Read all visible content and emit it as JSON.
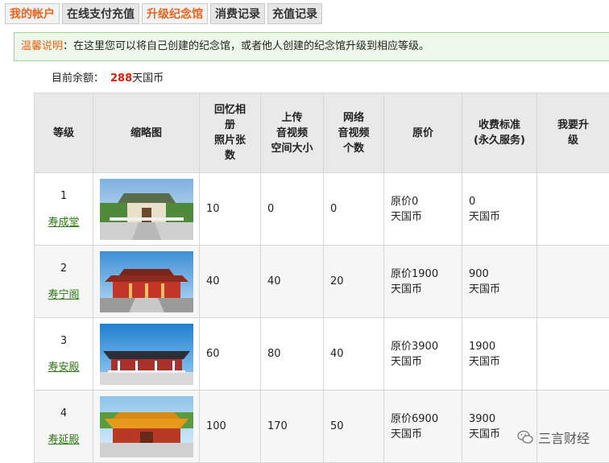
{
  "tabs": [
    {
      "label": "我的帐户"
    },
    {
      "label": "在线支付充值"
    },
    {
      "label": "升级纪念馆"
    },
    {
      "label": "消费记录"
    },
    {
      "label": "充值记录"
    }
  ],
  "notice": {
    "label": "温馨说明",
    "text": "：在这里您可以将自己创建的纪念馆，或者他人创建的纪念馆升级到相应等级。"
  },
  "balance": {
    "label": "目前余额：",
    "value": "288",
    "unit": "天国币"
  },
  "table": {
    "headers": {
      "level": "等级",
      "thumb": "缩略图",
      "photos": [
        "回忆相",
        "册",
        "照片张",
        "数"
      ],
      "space": [
        "上传",
        "音视频",
        "空间大小"
      ],
      "videos": [
        "网络",
        "音视频",
        "个数"
      ],
      "original": "原价",
      "fee": [
        "收费标准",
        "(永久服务)"
      ],
      "upgrade": [
        "我要升",
        "级"
      ]
    },
    "rows": [
      {
        "num": "1",
        "name": "寿成堂",
        "photos": "10",
        "space": "0",
        "videos": "0",
        "original": "原价0",
        "fee": "0",
        "unit": "天国币"
      },
      {
        "num": "2",
        "name": "寿宁阁",
        "photos": "40",
        "space": "40",
        "videos": "20",
        "original": "原价1900",
        "fee": "900",
        "unit": "天国币"
      },
      {
        "num": "3",
        "name": "寿安殿",
        "photos": "60",
        "space": "80",
        "videos": "40",
        "original": "原价3900",
        "fee": "1900",
        "unit": "天国币"
      },
      {
        "num": "4",
        "name": "寿延殿",
        "photos": "100",
        "space": "170",
        "videos": "50",
        "original": "原价6900",
        "fee": "3900",
        "unit": "天国币"
      }
    ]
  },
  "watermark": {
    "text": "三言财经"
  },
  "colors": {
    "accent": "#e8641b",
    "balance": "#d81e06",
    "link": "#2c7a12",
    "notice_bg": "#eef8ea",
    "notice_border": "#9fd68f"
  }
}
